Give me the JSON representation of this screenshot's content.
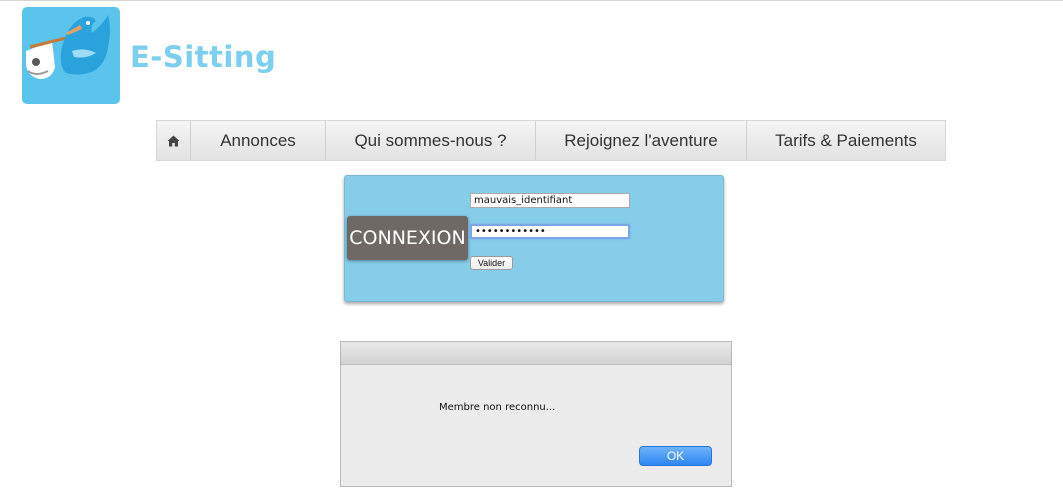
{
  "brand": {
    "name": "E-Sitting",
    "logo_icon": "stork-with-baby-icon"
  },
  "nav": {
    "home_icon": "home-icon",
    "items": [
      {
        "label": "Annonces"
      },
      {
        "label": "Qui sommes-nous ?"
      },
      {
        "label": "Rejoignez l'aventure"
      },
      {
        "label": "Tarifs & Paiements"
      }
    ]
  },
  "login": {
    "title": "CONNEXION",
    "username_value": "mauvais_identifiant",
    "password_value": "••••••••••••",
    "submit_label": "Valider"
  },
  "dialog": {
    "message": "Membre non reconnu...",
    "ok_label": "OK"
  },
  "colors": {
    "brand": "#7ccfee",
    "logo_bg": "#5bc4ec",
    "panel_bg": "#86cdea",
    "connexion_bg": "#6e6964",
    "ok_button": "#2f86f4"
  }
}
